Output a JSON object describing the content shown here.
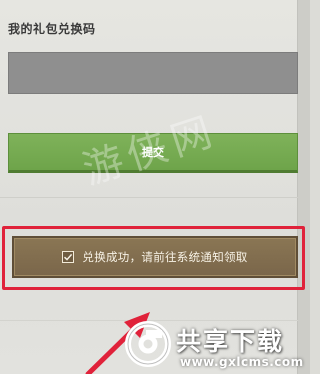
{
  "form": {
    "title": "我的礼包兑换码",
    "code_value": "",
    "submit_label": "提交"
  },
  "toast": {
    "message": "兑换成功，请前往系统通知领取"
  },
  "watermark": {
    "site_name": "共享下载",
    "site_url": "www.gxlcms.com",
    "overlay_text": "游侠网"
  },
  "colors": {
    "submit_green": "#74aa4f",
    "toast_brown": "#82704f",
    "highlight_red": "#e0223a",
    "input_gray": "#8f8f8f"
  }
}
